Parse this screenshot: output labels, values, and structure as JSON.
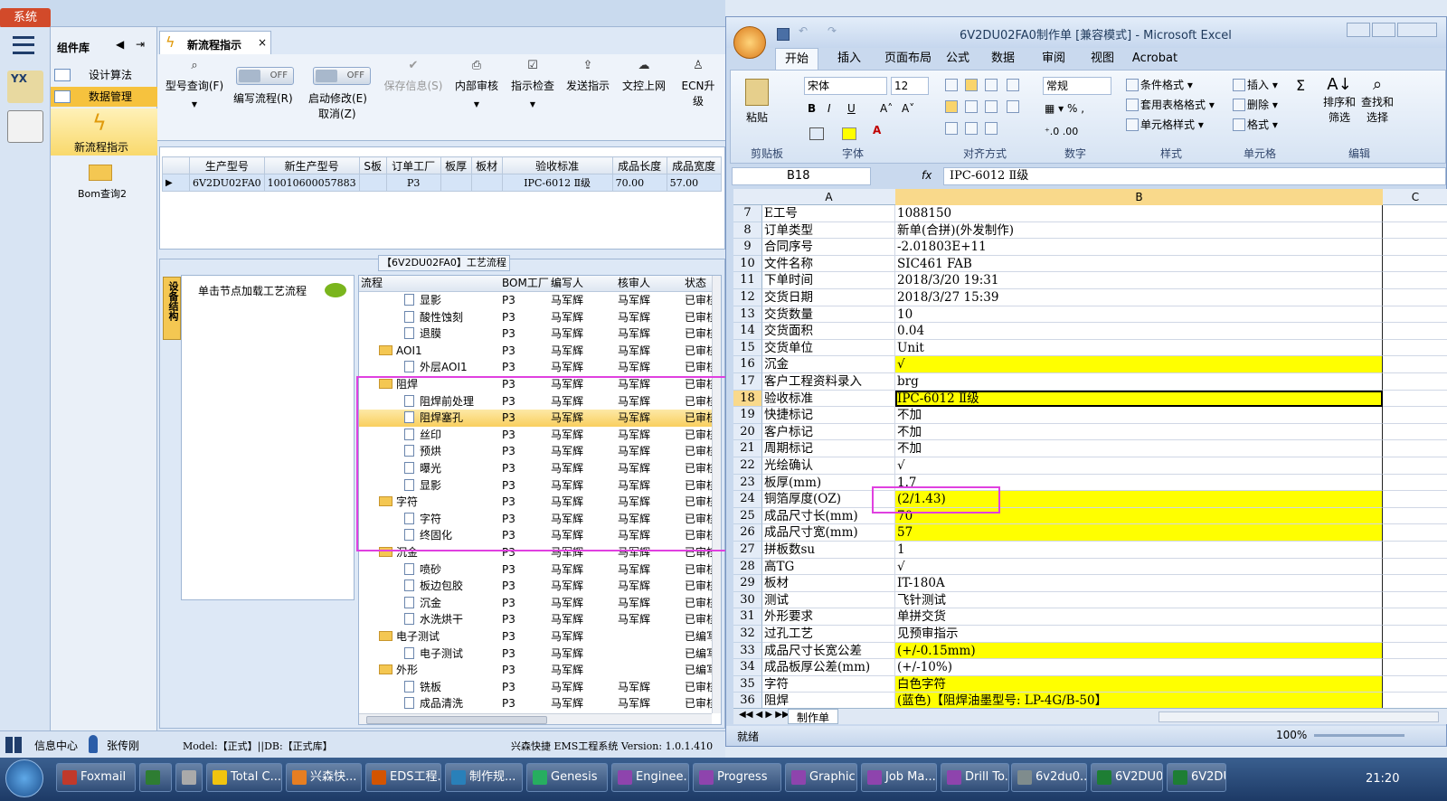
{
  "app": {
    "system_label": "系统"
  },
  "leftbar": {
    "components_title": "组件库",
    "nav": [
      {
        "label": "设计算法"
      },
      {
        "label": "数据管理"
      }
    ],
    "tools": [
      {
        "label": "新流程指示"
      },
      {
        "label": "Bom查询2"
      }
    ]
  },
  "tab": {
    "title": "新流程指示"
  },
  "toolbar": {
    "buttons": [
      {
        "label": "型号查询(F)",
        "icon": "search-icon"
      },
      {
        "label": "编写流程(R)",
        "toggle": "OFF"
      },
      {
        "label": "启动修改(E)",
        "sub": "取消(Z)",
        "toggle": "OFF"
      },
      {
        "label": "保存信息(S)",
        "icon": "check-icon"
      },
      {
        "label": "内部审核",
        "icon": "printer-icon"
      },
      {
        "label": "指示检查",
        "icon": "checkbox-icon"
      },
      {
        "label": "发送指示",
        "icon": "upload-icon"
      },
      {
        "label": "文控上网",
        "icon": "cloud-upload-icon"
      },
      {
        "label": "ECN升级",
        "icon": "person-icon"
      }
    ]
  },
  "order_grid": {
    "headers": [
      "生产型号",
      "新生产型号",
      "S板",
      "订单工厂",
      "板厚",
      "板材",
      "验收标准",
      "成品长度",
      "成品宽度"
    ],
    "rows": [
      [
        "6V2DU02FA0",
        "10010600057883",
        "",
        "P3",
        "",
        "",
        "IPC-6012 Ⅱ级",
        "70.00",
        "57.00"
      ]
    ]
  },
  "process": {
    "caption": "【6V2DU02FA0】工艺流程",
    "side_tab": "设备结构",
    "hint": "单击节点加载工艺流程",
    "headers": [
      "流程",
      "BOM工厂",
      "编写人",
      "核审人",
      "状态"
    ],
    "rows": [
      {
        "name": "显影",
        "lvl": 2,
        "f": "P3",
        "w": "马军辉",
        "r": "马军辉",
        "s": "已审核"
      },
      {
        "name": "酸性蚀刻",
        "lvl": 2,
        "f": "P3",
        "w": "马军辉",
        "r": "马军辉",
        "s": "已审核"
      },
      {
        "name": "退膜",
        "lvl": 2,
        "f": "P3",
        "w": "马军辉",
        "r": "马军辉",
        "s": "已审核"
      },
      {
        "name": "AOI1",
        "lvl": 1,
        "f": "P3",
        "w": "马军辉",
        "r": "马军辉",
        "s": "已审核"
      },
      {
        "name": "外层AOI1",
        "lvl": 2,
        "f": "P3",
        "w": "马军辉",
        "r": "马军辉",
        "s": "已审核"
      },
      {
        "name": "阻焊",
        "lvl": 1,
        "f": "P3",
        "w": "马军辉",
        "r": "马军辉",
        "s": "已审核"
      },
      {
        "name": "阻焊前处理",
        "lvl": 2,
        "f": "P3",
        "w": "马军辉",
        "r": "马军辉",
        "s": "已审核"
      },
      {
        "name": "阻焊塞孔",
        "lvl": 2,
        "f": "P3",
        "w": "马军辉",
        "r": "马军辉",
        "s": "已审核",
        "sel": true
      },
      {
        "name": "丝印",
        "lvl": 2,
        "f": "P3",
        "w": "马军辉",
        "r": "马军辉",
        "s": "已审核"
      },
      {
        "name": "预烘",
        "lvl": 2,
        "f": "P3",
        "w": "马军辉",
        "r": "马军辉",
        "s": "已审核"
      },
      {
        "name": "曝光",
        "lvl": 2,
        "f": "P3",
        "w": "马军辉",
        "r": "马军辉",
        "s": "已审核"
      },
      {
        "name": "显影",
        "lvl": 2,
        "f": "P3",
        "w": "马军辉",
        "r": "马军辉",
        "s": "已审核"
      },
      {
        "name": "字符",
        "lvl": 1,
        "f": "P3",
        "w": "马军辉",
        "r": "马军辉",
        "s": "已审核"
      },
      {
        "name": "字符",
        "lvl": 2,
        "f": "P3",
        "w": "马军辉",
        "r": "马军辉",
        "s": "已审核"
      },
      {
        "name": "终固化",
        "lvl": 2,
        "f": "P3",
        "w": "马军辉",
        "r": "马军辉",
        "s": "已审核"
      },
      {
        "name": "沉金",
        "lvl": 1,
        "f": "P3",
        "w": "马军辉",
        "r": "马军辉",
        "s": "已审核"
      },
      {
        "name": "喷砂",
        "lvl": 2,
        "f": "P3",
        "w": "马军辉",
        "r": "马军辉",
        "s": "已审核"
      },
      {
        "name": "板边包胶",
        "lvl": 2,
        "f": "P3",
        "w": "马军辉",
        "r": "马军辉",
        "s": "已审核"
      },
      {
        "name": "沉金",
        "lvl": 2,
        "f": "P3",
        "w": "马军辉",
        "r": "马军辉",
        "s": "已审核"
      },
      {
        "name": "水洗烘干",
        "lvl": 2,
        "f": "P3",
        "w": "马军辉",
        "r": "马军辉",
        "s": "已审核"
      },
      {
        "name": "电子测试",
        "lvl": 1,
        "f": "P3",
        "w": "马军辉",
        "r": "",
        "s": "已编写"
      },
      {
        "name": "电子测试",
        "lvl": 2,
        "f": "P3",
        "w": "马军辉",
        "r": "",
        "s": "已编写"
      },
      {
        "name": "外形",
        "lvl": 1,
        "f": "P3",
        "w": "马军辉",
        "r": "",
        "s": "已编写"
      },
      {
        "name": "铣板",
        "lvl": 2,
        "f": "P3",
        "w": "马军辉",
        "r": "马军辉",
        "s": "已审核"
      },
      {
        "name": "成品清洗",
        "lvl": 2,
        "f": "P3",
        "w": "马军辉",
        "r": "马军辉",
        "s": "已审核"
      }
    ]
  },
  "status": {
    "info_center": "信息中心",
    "user": "张传刚",
    "model": "Model:【正式】||DB:【正式库】",
    "system": "兴森快捷 EMS工程系统 Version: 1.0.1.410"
  },
  "excel": {
    "title": "6V2DU02FA0制作单 [兼容模式] - Microsoft Excel",
    "tabs": [
      "开始",
      "插入",
      "页面布局",
      "公式",
      "数据",
      "审阅",
      "视图",
      "Acrobat"
    ],
    "clipboard": {
      "paste": "粘贴",
      "group": "剪贴板"
    },
    "font": {
      "name": "宋体",
      "size": "12",
      "group": "字体"
    },
    "align_group": "对齐方式",
    "number": {
      "format": "常规",
      "group": "数字"
    },
    "styles": {
      "cond": "条件格式",
      "table": "套用表格格式",
      "cell": "单元格样式",
      "group": "样式"
    },
    "cells": {
      "insert": "插入",
      "delete": "删除",
      "format": "格式",
      "group": "单元格"
    },
    "edit": {
      "sort": "排序和",
      "sort2": "筛选",
      "find": "查找和",
      "find2": "选择",
      "group": "编辑"
    },
    "namebox": "B18",
    "fx": "fx",
    "formula": "IPC-6012 Ⅱ级",
    "cols": [
      "A",
      "B",
      "C"
    ],
    "rows": [
      {
        "n": "7",
        "a": "E工号",
        "b": "1088150"
      },
      {
        "n": "8",
        "a": "订单类型",
        "b": "新单(合拼)(外发制作)"
      },
      {
        "n": "9",
        "a": "合同序号",
        "b": "-2.01803E+11"
      },
      {
        "n": "10",
        "a": "文件名称",
        "b": "SIC461 FAB"
      },
      {
        "n": "11",
        "a": "下单时间",
        "b": "2018/3/20 19:31"
      },
      {
        "n": "12",
        "a": "交货日期",
        "b": "2018/3/27 15:39"
      },
      {
        "n": "13",
        "a": "交货数量",
        "b": "10"
      },
      {
        "n": "14",
        "a": "交货面积",
        "b": "0.04"
      },
      {
        "n": "15",
        "a": "交货单位",
        "b": "Unit"
      },
      {
        "n": "16",
        "a": "沉金",
        "b": "√",
        "y": true
      },
      {
        "n": "17",
        "a": "客户工程资料录入",
        "b": "brg"
      },
      {
        "n": "18",
        "a": "验收标准",
        "b": "IPC-6012 Ⅱ级",
        "y": true,
        "sel": true
      },
      {
        "n": "19",
        "a": "快捷标记",
        "b": "不加"
      },
      {
        "n": "20",
        "a": "客户标记",
        "b": "不加"
      },
      {
        "n": "21",
        "a": "周期标记",
        "b": "不加"
      },
      {
        "n": "22",
        "a": "光绘确认",
        "b": "√"
      },
      {
        "n": "23",
        "a": "板厚(mm)",
        "b": "1.7"
      },
      {
        "n": "24",
        "a": "铜箔厚度(OZ)",
        "b": "(2/1.43)",
        "y": true
      },
      {
        "n": "25",
        "a": "成品尺寸长(mm)",
        "b": "70",
        "y": true
      },
      {
        "n": "26",
        "a": "成品尺寸宽(mm)",
        "b": "57",
        "y": true
      },
      {
        "n": "27",
        "a": "拼板数su",
        "b": "1"
      },
      {
        "n": "28",
        "a": "高TG",
        "b": "√"
      },
      {
        "n": "29",
        "a": "板材",
        "b": "IT-180A"
      },
      {
        "n": "30",
        "a": "测试",
        "b": "飞针测试"
      },
      {
        "n": "31",
        "a": "外形要求",
        "b": "单拼交货"
      },
      {
        "n": "32",
        "a": "过孔工艺",
        "b": "见预审指示"
      },
      {
        "n": "33",
        "a": "成品尺寸长宽公差",
        "b": "(+/-0.15mm)",
        "y": true
      },
      {
        "n": "34",
        "a": "成品板厚公差(mm)",
        "b": "(+/-10%)"
      },
      {
        "n": "35",
        "a": "字符",
        "b": "白色字符",
        "y": true
      },
      {
        "n": "36",
        "a": "阻焊",
        "b": "(蓝色)【阻焊油墨型号: LP-4G/B-50】",
        "y": true
      }
    ],
    "sheet_tab": "制作单",
    "ready": "就绪",
    "zoom": "100%"
  },
  "taskbar": {
    "items": [
      {
        "label": "Foxmail",
        "c": "#c0392b"
      },
      {
        "label": "",
        "c": "#2e7d32"
      },
      {
        "label": "",
        "c": "#aaa"
      },
      {
        "label": "Total C...",
        "c": "#f1c40f"
      },
      {
        "label": "兴森快...",
        "c": "#e67e22"
      },
      {
        "label": "EDS工程...",
        "c": "#d35400"
      },
      {
        "label": "制作规...",
        "c": "#2980b9"
      },
      {
        "label": "Genesis",
        "c": "#27ae60"
      },
      {
        "label": "Enginee...",
        "c": "#8e44ad"
      },
      {
        "label": "Progress",
        "c": "#8e44ad"
      },
      {
        "label": "Graphic...",
        "c": "#8e44ad"
      },
      {
        "label": "Job Ma...",
        "c": "#8e44ad"
      },
      {
        "label": "Drill To...",
        "c": "#8e44ad"
      },
      {
        "label": "6v2du0...",
        "c": "#7f8c8d"
      },
      {
        "label": "6V2DU0...",
        "c": "#1e7e34"
      },
      {
        "label": "6V2DU...",
        "c": "#1e7e34"
      }
    ],
    "time": "21:20"
  }
}
